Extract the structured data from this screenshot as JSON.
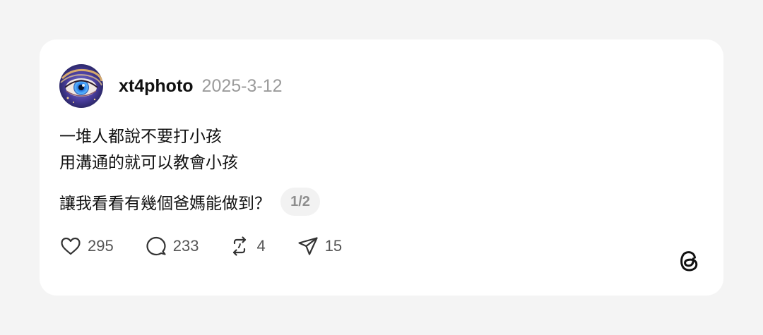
{
  "post": {
    "username": "xt4photo",
    "date": "2025-3-12",
    "lines": [
      "一堆人都說不要打小孩",
      "用溝通的就可以教會小孩",
      "讓我看看有幾個爸媽能做到？"
    ],
    "page_indicator": "1/2"
  },
  "actions": {
    "likes": "295",
    "comments": "233",
    "reposts": "4",
    "shares": "15"
  },
  "icons": {
    "like": "heart-icon",
    "comment": "comment-bubble-icon",
    "repost": "repost-icon",
    "share": "send-icon",
    "brand": "threads-logo-icon"
  },
  "colors": {
    "background": "#f4f4f4",
    "card": "#ffffff",
    "text": "#111111",
    "muted": "#9b9b9b",
    "count": "#555555"
  }
}
